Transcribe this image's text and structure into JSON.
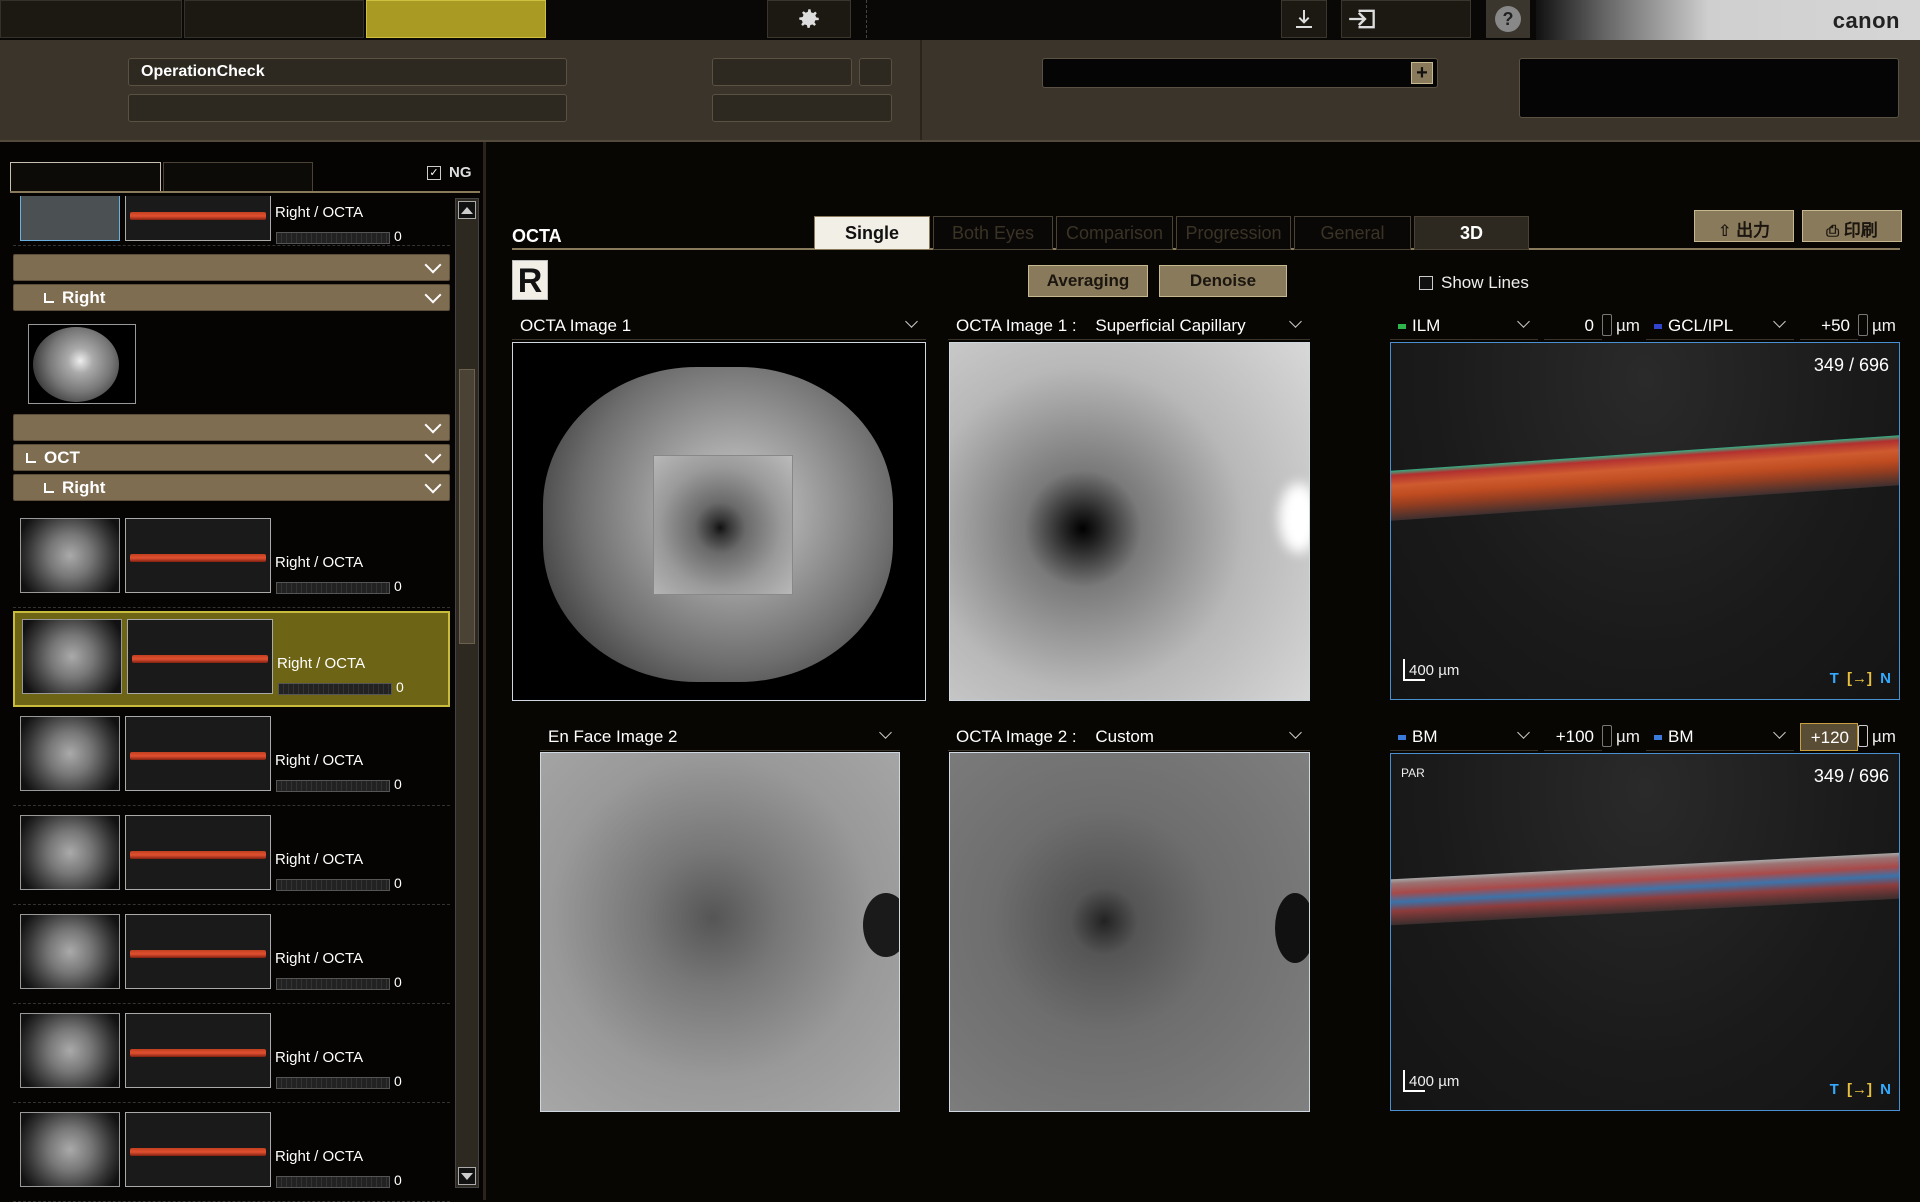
{
  "brand": "canon",
  "header": {
    "patient_field": "OperationCheck"
  },
  "sidebar": {
    "tab_ng_label": "NG",
    "groups": {
      "right1": "Right",
      "oct": "OCT",
      "right2": "Right"
    },
    "items": [
      {
        "label": "Right / OCTA",
        "count": "0"
      },
      {
        "label": "Right / OCTA",
        "count": "0"
      },
      {
        "label": "Right / OCTA",
        "count": "0"
      },
      {
        "label": "Right / OCTA",
        "count": "0"
      },
      {
        "label": "Right / OCTA",
        "count": "0"
      },
      {
        "label": "Right / OCTA",
        "count": "0"
      },
      {
        "label": "Right / OCTA",
        "count": "0"
      },
      {
        "label": "Right / OCTA",
        "count": "0"
      }
    ]
  },
  "main": {
    "section_title": "OCTA",
    "tabs": [
      "Single",
      "Both Eyes",
      "Comparison",
      "Progression",
      "General",
      "3D"
    ],
    "output_btn": "出力",
    "print_btn": "印刷",
    "eye_badge": "R",
    "averaging": "Averaging",
    "denoise": "Denoise",
    "show_lines": "Show Lines",
    "panels": {
      "p1": "OCTA Image 1",
      "p2_label": "OCTA Image 1 :",
      "p2_value": "Superficial Capillary",
      "p3": "En Face Image 2",
      "p4_label": "OCTA Image 2 :",
      "p4_value": "Custom"
    },
    "bscan_top": {
      "layer1": "ILM",
      "offset1": "0",
      "layer2": "GCL/IPL",
      "offset2": "+50",
      "unit": "µm",
      "counter": "349 / 696",
      "scale": "400 µm",
      "tn_t": "T",
      "tn_n": "N"
    },
    "bscan_bottom": {
      "layer1": "BM",
      "offset1": "+100",
      "layer2": "BM",
      "offset2": "+120",
      "unit": "µm",
      "counter": "349 / 696",
      "scale": "400 µm",
      "par": "PAR",
      "tn_t": "T",
      "tn_n": "N"
    }
  },
  "colors": {
    "accent_yellow": "#a89a22",
    "selected_bg": "#6e6415",
    "button_bg": "#8a7a5c",
    "bscan_border": "#4a90d0"
  }
}
